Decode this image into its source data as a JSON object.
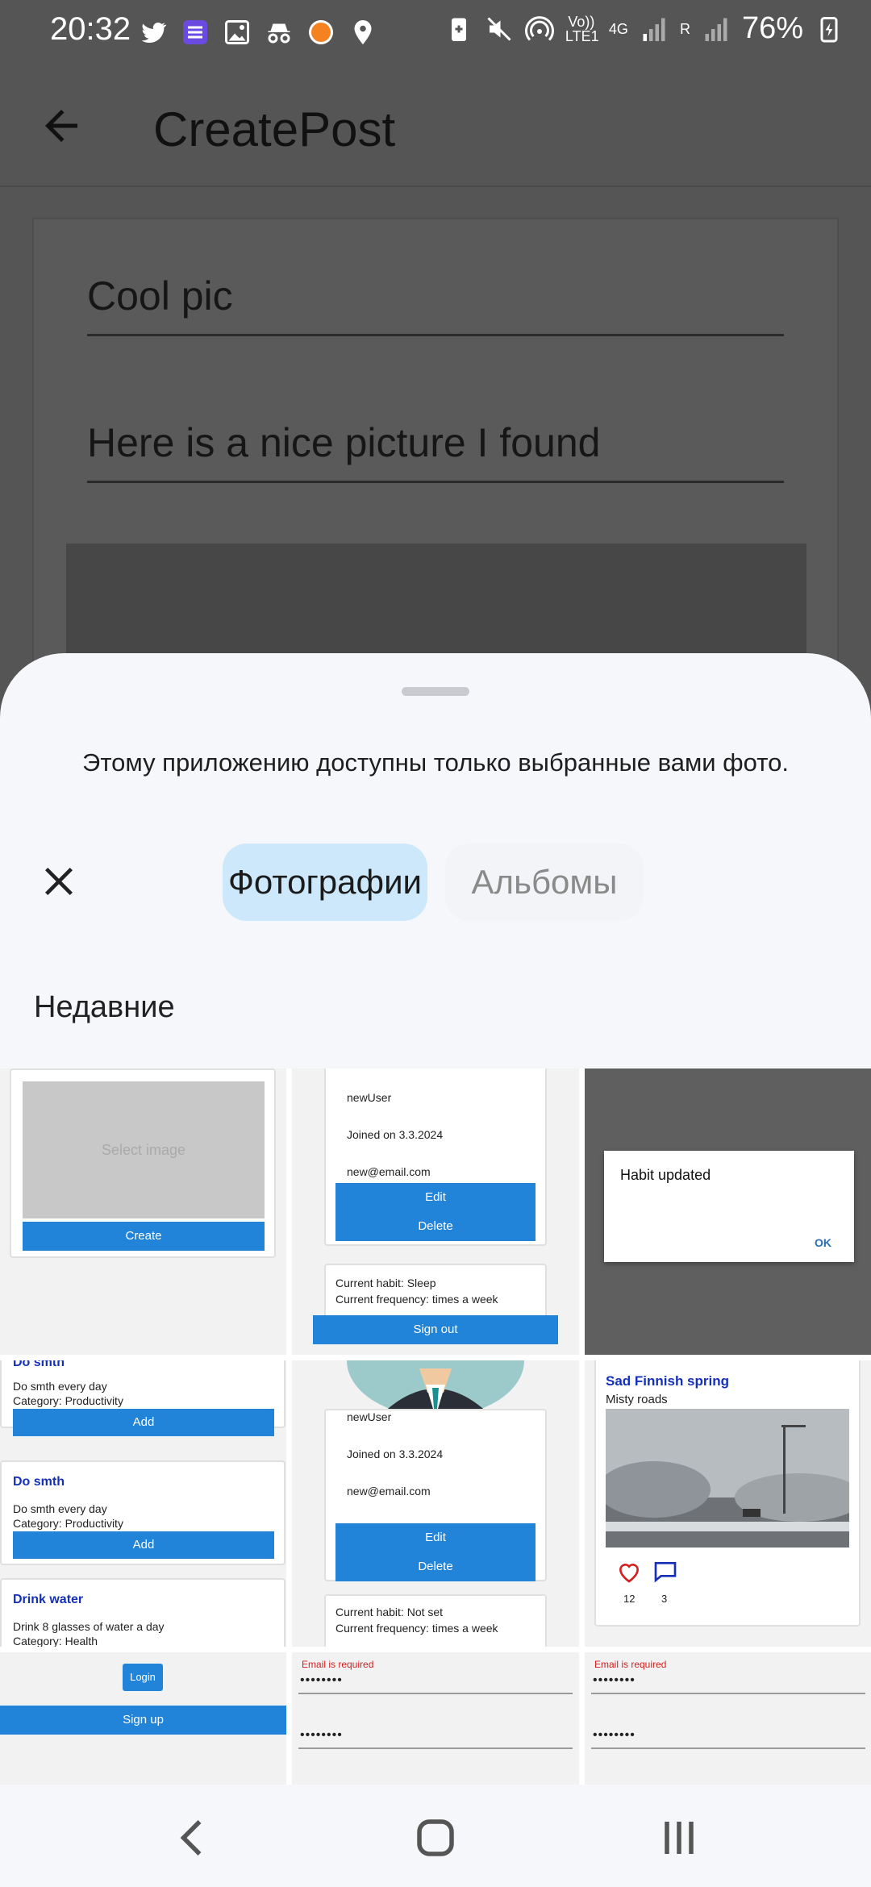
{
  "status_bar": {
    "time": "20:32",
    "left_icons": [
      "twitter-icon",
      "list-app-icon",
      "gallery-icon",
      "incognito-icon",
      "orange-app-icon",
      "location-icon"
    ],
    "volte": "Vo)) LTE1",
    "net": "4G",
    "roam": "R",
    "battery": "76%"
  },
  "app_bar": {
    "title": "CreatePost"
  },
  "form": {
    "title_value": "Cool pic",
    "description_value": "Here is a nice picture I found"
  },
  "sheet": {
    "notice": "Этому приложению доступны только выбранные вами фото.",
    "tabs": [
      {
        "label": "Фотографии",
        "active": true
      },
      {
        "label": "Альбомы",
        "active": false
      }
    ],
    "section": "Недавние"
  },
  "thumbnails": {
    "t1": {
      "placeholder": "Select image",
      "button": "Create"
    },
    "t2": {
      "username": "newUser",
      "joined": "Joined on 3.3.2024",
      "email": "new@email.com",
      "edit": "Edit",
      "delete": "Delete",
      "habit": "Current habit: Sleep",
      "frequency": "Current frequency:  times a week",
      "signout": "Sign out"
    },
    "t3": {
      "dialog_text": "Habit updated",
      "ok": "OK"
    },
    "t4": {
      "items": [
        {
          "title": "Do smth",
          "desc": "Do smth every day",
          "category": "Category: Productivity",
          "button": "Add"
        },
        {
          "title": "Do smth",
          "desc": "Do smth every day",
          "category": "Category: Productivity",
          "button": "Add"
        },
        {
          "title": "Drink water",
          "desc": "Drink 8 glasses of water a day",
          "category": "Category: Health"
        }
      ]
    },
    "t5": {
      "username": "newUser",
      "joined": "Joined on 3.3.2024",
      "email": "new@email.com",
      "edit": "Edit",
      "delete": "Delete",
      "habit": "Current habit: Not set",
      "frequency": "Current frequency:  times a week"
    },
    "t6": {
      "title": "Sad Finnish spring",
      "subtitle": "Misty roads",
      "likes": "12",
      "comments": "3"
    },
    "t7": {
      "login": "Login",
      "signup": "Sign up"
    },
    "t8": {
      "error": "Email is required",
      "pw1": "••••••••",
      "pw2": "••••••••"
    },
    "t9": {
      "error": "Email is required",
      "pw1": "••••••••",
      "pw2": "••••••••"
    }
  },
  "colors": {
    "accent": "#2184d8",
    "tab_active_bg": "#cce8fa",
    "scrim": "#555555"
  }
}
